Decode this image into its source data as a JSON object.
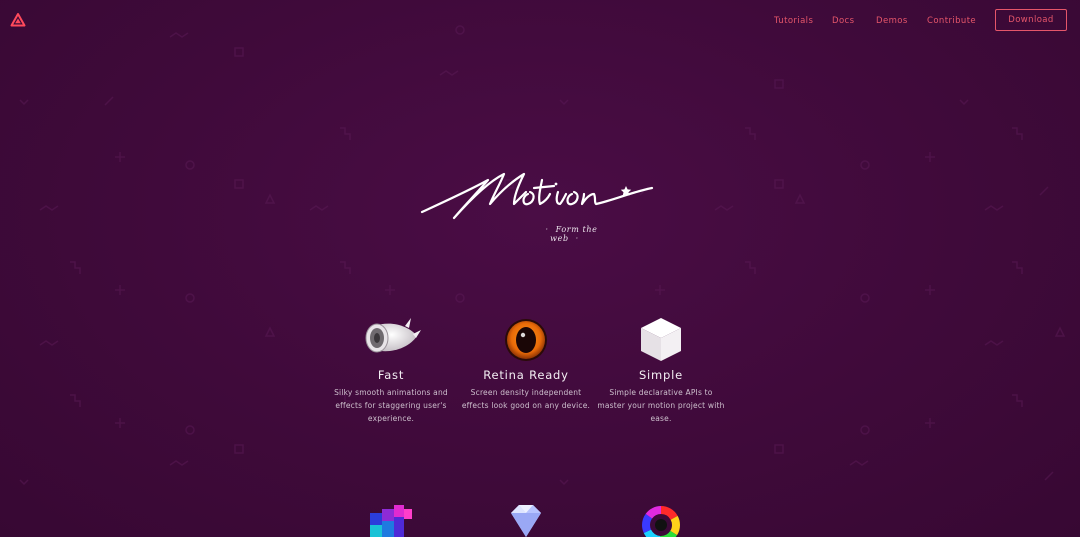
{
  "nav": {
    "items": [
      {
        "label": "Tutorials"
      },
      {
        "label": "Docs"
      },
      {
        "label": "Demos"
      },
      {
        "label": "Contribute"
      }
    ],
    "download_label": "Download"
  },
  "hero": {
    "logo_text": "Motion",
    "tagline": "Form the web"
  },
  "features": [
    {
      "title": "Fast",
      "description": "Silky smooth animations and effects for staggering user's experience.",
      "icon": "jet-engine-icon"
    },
    {
      "title": "Retina Ready",
      "description": "Screen density independent effects look good on any device.",
      "icon": "eye-icon"
    },
    {
      "title": "Simple",
      "description": "Simple declarative APIs to master your motion project with ease.",
      "icon": "cube-icon"
    }
  ],
  "more_features_icons": [
    "colorful-blocks-icon",
    "diamond-icon",
    "color-wheel-icon"
  ],
  "colors": {
    "background": "#3f0a3a",
    "accent": "#e5566a",
    "text": "#f3eef3"
  }
}
